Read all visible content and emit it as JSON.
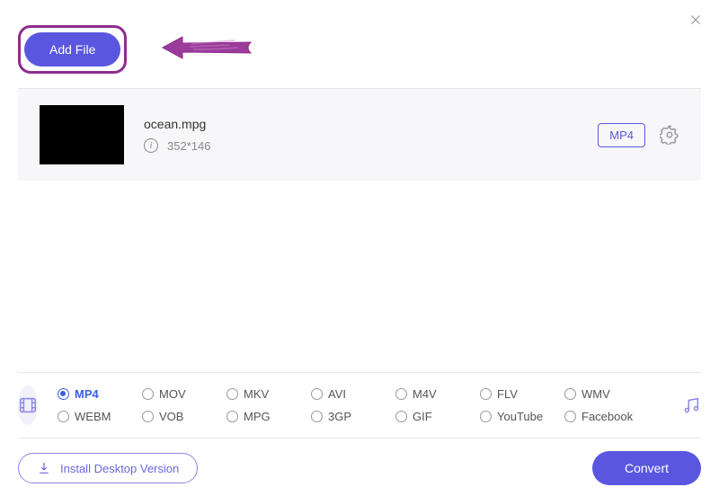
{
  "header": {
    "add_file_label": "Add File"
  },
  "file": {
    "name": "ocean.mpg",
    "resolution": "352*146",
    "output_format": "MP4"
  },
  "formats": {
    "row1": [
      "MP4",
      "MOV",
      "MKV",
      "AVI",
      "M4V",
      "FLV",
      "WMV"
    ],
    "row2": [
      "WEBM",
      "VOB",
      "MPG",
      "3GP",
      "GIF",
      "YouTube",
      "Facebook"
    ],
    "selected": "MP4"
  },
  "bottom": {
    "install_label": "Install Desktop Version",
    "convert_label": "Convert"
  }
}
